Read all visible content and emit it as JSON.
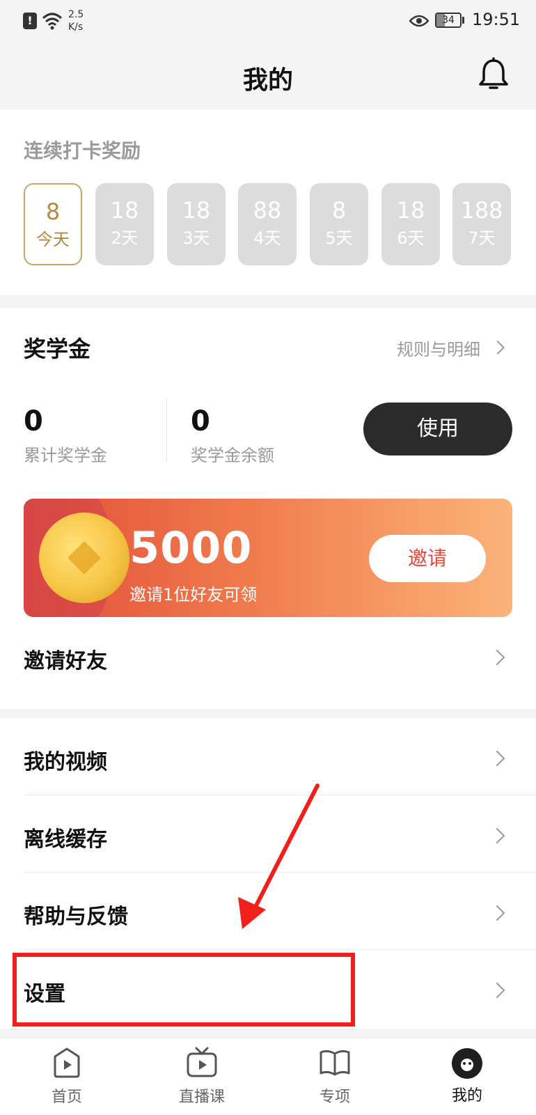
{
  "status_bar": {
    "alert": "!",
    "net_speed_value": "2.5",
    "net_speed_unit": "K/s",
    "battery": "34",
    "battery_level": 0.34,
    "time": "19:51"
  },
  "header": {
    "title": "我的",
    "notification_icon": "bell-icon"
  },
  "checkin": {
    "title": "连续打卡奖励",
    "days": [
      {
        "amount": "8",
        "label": "今天",
        "active": true
      },
      {
        "amount": "18",
        "label": "2天",
        "active": false
      },
      {
        "amount": "18",
        "label": "3天",
        "active": false
      },
      {
        "amount": "88",
        "label": "4天",
        "active": false
      },
      {
        "amount": "8",
        "label": "5天",
        "active": false
      },
      {
        "amount": "18",
        "label": "6天",
        "active": false
      },
      {
        "amount": "188",
        "label": "7天",
        "active": false
      }
    ]
  },
  "scholarship": {
    "title": "奖学金",
    "rules_link": "规则与明细",
    "total_value": "0",
    "total_label": "累计奖学金",
    "balance_value": "0",
    "balance_label": "奖学金余额",
    "use_button": "使用",
    "banner": {
      "amount": "5000",
      "subtitle": "邀请1位好友可领",
      "invite_button": "邀请"
    },
    "invite_friends": "邀请好友"
  },
  "menu": {
    "items": [
      {
        "label": "我的视频"
      },
      {
        "label": "离线缓存"
      },
      {
        "label": "帮助与反馈"
      },
      {
        "label": "设置"
      }
    ]
  },
  "tabbar": {
    "tabs": [
      {
        "label": "首页",
        "icon": "play-circle-icon"
      },
      {
        "label": "直播课",
        "icon": "tv-icon"
      },
      {
        "label": "专项",
        "icon": "book-icon"
      },
      {
        "label": "我的",
        "icon": "avatar-icon"
      }
    ]
  },
  "colors": {
    "accent_gold": "#c9a56a",
    "banner_start": "#e24e3a",
    "banner_end": "#fbb37a",
    "annotation_red": "#f2201a",
    "button_dark": "#2b2b2b"
  }
}
